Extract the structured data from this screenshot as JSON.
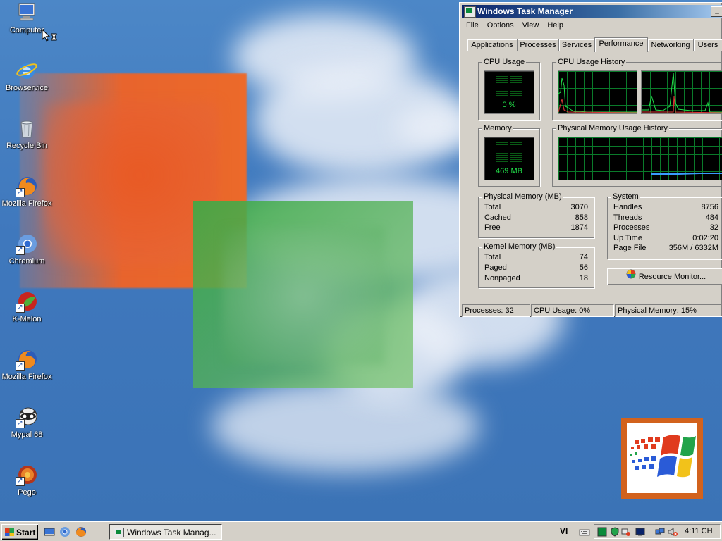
{
  "desktop": {
    "icons": [
      {
        "label": "Computer"
      },
      {
        "label": "Browservice"
      },
      {
        "label": "Recycle Bin"
      },
      {
        "label": "Mozilla Firefox"
      },
      {
        "label": "Chromium"
      },
      {
        "label": "K-Melon"
      },
      {
        "label": "Mozilla Firefox"
      },
      {
        "label": "Mypal 68"
      },
      {
        "label": "Pego"
      }
    ]
  },
  "task_manager": {
    "title": "Windows Task Manager",
    "menu": [
      "File",
      "Options",
      "View",
      "Help"
    ],
    "tabs": [
      {
        "label": "Applications",
        "active": false
      },
      {
        "label": "Processes",
        "active": false
      },
      {
        "label": "Services",
        "active": false
      },
      {
        "label": "Performance",
        "active": true
      },
      {
        "label": "Networking",
        "active": false
      },
      {
        "label": "Users",
        "active": false
      }
    ],
    "cpu_usage": {
      "label": "CPU Usage",
      "value": "0 %"
    },
    "cpu_history": {
      "label": "CPU Usage History"
    },
    "memory": {
      "label": "Memory",
      "value": "469 MB"
    },
    "memory_history": {
      "label": "Physical Memory Usage History"
    },
    "physical_memory": {
      "label": "Physical Memory (MB)",
      "rows": [
        {
          "name": "Total",
          "value": "3070"
        },
        {
          "name": "Cached",
          "value": "858"
        },
        {
          "name": "Free",
          "value": "1874"
        }
      ]
    },
    "kernel_memory": {
      "label": "Kernel Memory (MB)",
      "rows": [
        {
          "name": "Total",
          "value": "74"
        },
        {
          "name": "Paged",
          "value": "56"
        },
        {
          "name": "Nonpaged",
          "value": "18"
        }
      ]
    },
    "system": {
      "label": "System",
      "rows": [
        {
          "name": "Handles",
          "value": "8756"
        },
        {
          "name": "Threads",
          "value": "484"
        },
        {
          "name": "Processes",
          "value": "32"
        },
        {
          "name": "Up Time",
          "value": "0:02:20"
        },
        {
          "name": "Page File",
          "value": "356M / 6332M"
        }
      ]
    },
    "resource_monitor_label": "Resource Monitor...",
    "status": {
      "processes": "Processes: 32",
      "cpu": "CPU Usage: 0%",
      "memory": "Physical Memory: 15%"
    }
  },
  "taskbar": {
    "start_label": "Start",
    "task_button": "Windows Task Manag...",
    "language": "VI",
    "clock": "4:11 CH"
  },
  "colors": {
    "graph_green": "#22e24a",
    "grid_green": "#0a7a2a",
    "title_blue": "#0a246a"
  }
}
